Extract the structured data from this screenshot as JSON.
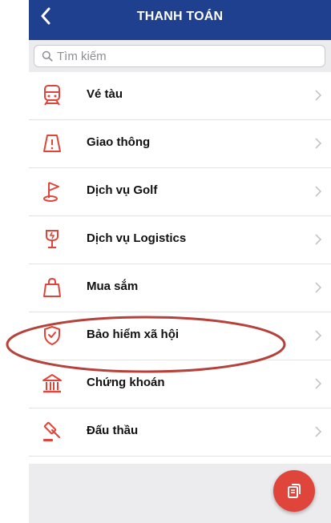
{
  "header": {
    "title": "THANH TOÁN"
  },
  "search": {
    "placeholder": "Tìm kiếm"
  },
  "items": [
    {
      "label": "Vé tàu",
      "icon": "train-icon"
    },
    {
      "label": "Giao thông",
      "icon": "traffic-sign-icon"
    },
    {
      "label": "Dịch vụ Golf",
      "icon": "golf-flag-icon"
    },
    {
      "label": "Dịch vụ Logistics",
      "icon": "fragile-glass-icon"
    },
    {
      "label": "Mua sắm",
      "icon": "shopping-bag-icon"
    },
    {
      "label": "Bảo hiểm xã hội",
      "icon": "shield-check-icon"
    },
    {
      "label": "Chứng khoán",
      "icon": "bank-building-icon"
    },
    {
      "label": "Đấu thầu",
      "icon": "auction-gavel-icon"
    }
  ],
  "colors": {
    "header": "#1f3f8f",
    "accent": "#e0453b",
    "annotation": "#b5413b"
  }
}
